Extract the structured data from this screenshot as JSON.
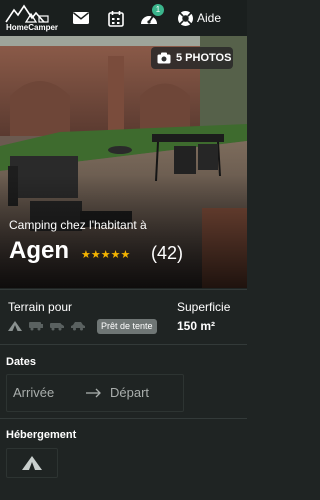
{
  "header": {
    "logo_text": "HomeCamper",
    "messages_icon": "envelope-icon",
    "calendar_icon": "calendar-icon",
    "dashboard_icon": "speedometer-icon",
    "notification_count": "1",
    "help_icon": "lifebuoy-icon",
    "help_label": "Aide"
  },
  "hero": {
    "photos_label": "5 PHOTOS",
    "subtitle": "Camping chez l'habitant à",
    "title": "Agen",
    "stars": "★★★★★",
    "review_count": "(42)"
  },
  "details": {
    "terrain_label": "Terrain pour",
    "vehicle_icons": [
      "tent-icon",
      "campervan-icon",
      "van-icon",
      "car-icon"
    ],
    "tent_badge": "Prêt de tente",
    "surface_label": "Superficie",
    "surface_value": "150 m²"
  },
  "dates": {
    "title": "Dates",
    "arrival_placeholder": "Arrivée",
    "departure_placeholder": "Départ"
  },
  "accommodation": {
    "title": "Hébergement",
    "option_icon": "tent-icon"
  },
  "colors": {
    "accent": "#3bb58c",
    "background": "#1f2423",
    "star": "#f5b400"
  }
}
